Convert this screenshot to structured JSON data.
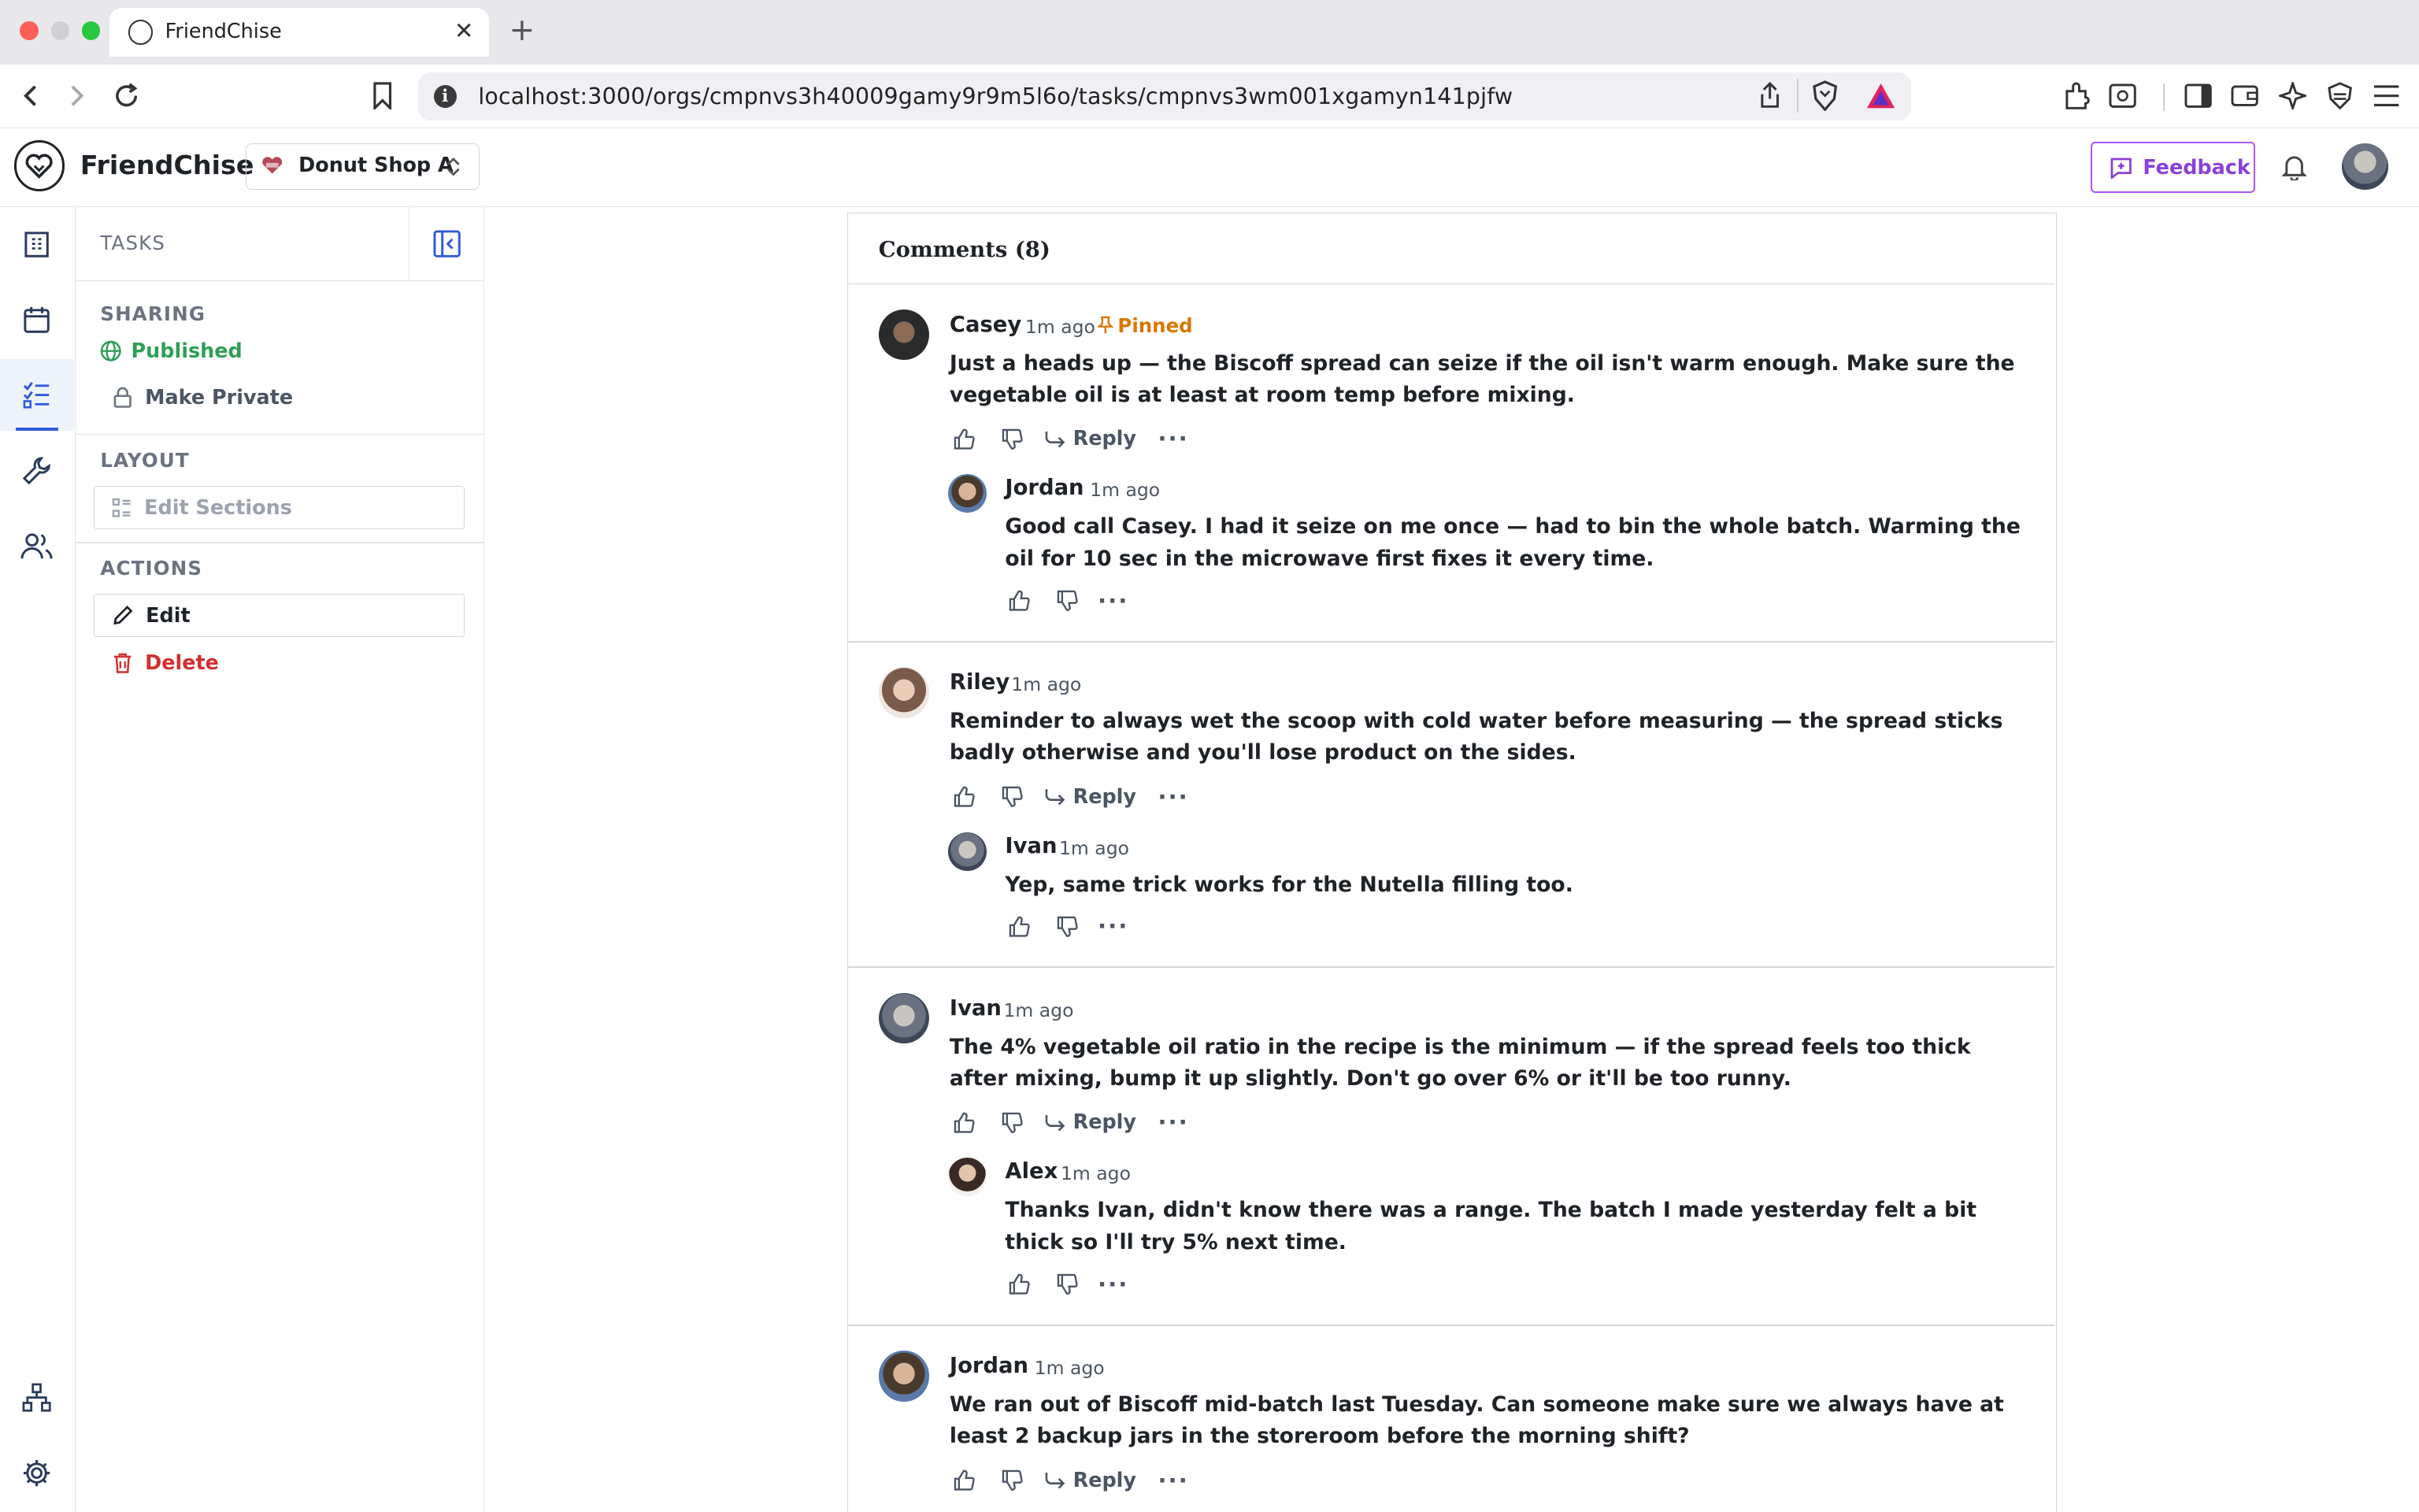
{
  "browser": {
    "tab_title": "FriendChise",
    "url": "localhost:3000/orgs/cmpnvs3h40009gamy9r9m5l6o/tasks/cmpnvs3wm001xgamyn141pjfw"
  },
  "header": {
    "brand": "FriendChise",
    "org_name": "Donut Shop A",
    "feedback_label": "Feedback"
  },
  "panel": {
    "title": "TASKS",
    "sharing_label": "SHARING",
    "published_label": "Published",
    "make_private_label": "Make Private",
    "layout_label": "LAYOUT",
    "edit_sections_label": "Edit Sections",
    "actions_label": "ACTIONS",
    "edit_label": "Edit",
    "delete_label": "Delete"
  },
  "comments": {
    "title": "Comments (8)",
    "reply_label": "Reply",
    "pinned_label": "Pinned",
    "items": [
      {
        "name": "Casey",
        "time": "1m ago",
        "body": "Just a heads up — the Biscoff spread can seize if the oil isn't warm enough. Make sure the vegetable oil is at least at room temp before mixing."
      },
      {
        "name": "Jordan",
        "time": "1m ago",
        "body": "Good call Casey. I had it seize on me once — had to bin the whole batch. Warming the oil for 10 sec in the microwave first fixes it every time."
      },
      {
        "name": "Riley",
        "time": "1m ago",
        "body": "Reminder to always wet the scoop with cold water before measuring — the spread sticks badly otherwise and you'll lose product on the sides."
      },
      {
        "name": "Ivan",
        "time": "1m ago",
        "body": "Yep, same trick works for the Nutella filling too."
      },
      {
        "name": "Ivan",
        "time": "1m ago",
        "body": "The 4% vegetable oil ratio in the recipe is the minimum — if the spread feels too thick after mixing, bump it up slightly. Don't go over 6% or it'll be too runny."
      },
      {
        "name": "Alex",
        "time": "1m ago",
        "body": "Thanks Ivan, didn't know there was a range. The batch I made yesterday felt a bit thick so I'll try 5% next time."
      },
      {
        "name": "Jordan",
        "time": "1m ago",
        "body": "We ran out of Biscoff mid-batch last Tuesday. Can someone make sure we always have at least 2 backup jars in the storeroom before the morning shift?"
      }
    ]
  },
  "colors": {
    "accent_blue": "#2f5bd9",
    "published_green": "#2f9e57",
    "delete_red": "#d32f2f",
    "pinned_orange": "#d97706",
    "feedback_purple": "#a855f7"
  }
}
